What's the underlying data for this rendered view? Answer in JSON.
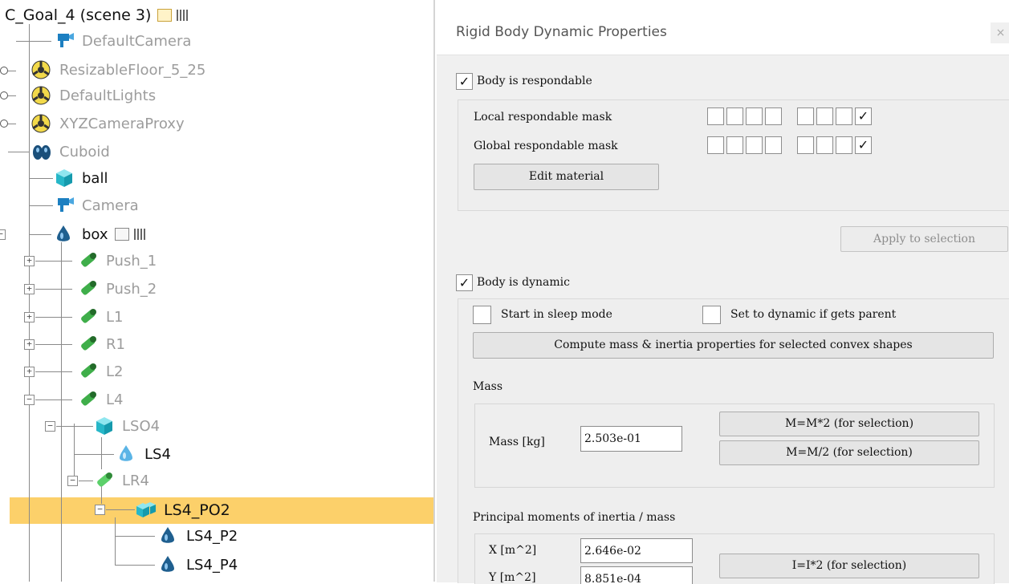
{
  "tree": {
    "header": "C_Goal_4 (scene 3)",
    "items": [
      {
        "label": "DefaultCamera",
        "icon": "camera-icon"
      },
      {
        "label": "ResizableFloor_5_25",
        "icon": "model-icon"
      },
      {
        "label": "DefaultLights",
        "icon": "model-icon"
      },
      {
        "label": "XYZCameraProxy",
        "icon": "model-icon"
      },
      {
        "label": "Cuboid",
        "icon": "pure-shape-icon"
      },
      {
        "label": "ball",
        "icon": "cube-icon"
      },
      {
        "label": "Camera",
        "icon": "camera-icon"
      },
      {
        "label": "box",
        "icon": "drop-shape-icon"
      },
      {
        "label": "Push_1",
        "icon": "joint-icon"
      },
      {
        "label": "Push_2",
        "icon": "joint-icon"
      },
      {
        "label": "L1",
        "icon": "joint-icon"
      },
      {
        "label": "R1",
        "icon": "joint-icon"
      },
      {
        "label": "L2",
        "icon": "joint-icon"
      },
      {
        "label": "L4",
        "icon": "joint-icon"
      },
      {
        "label": "LSO4",
        "icon": "cube-icon"
      },
      {
        "label": "LS4",
        "icon": "drop-shape-icon"
      },
      {
        "label": "LR4",
        "icon": "joint-icon"
      },
      {
        "label": "LS4_PO2",
        "icon": "compound-shape-icon"
      },
      {
        "label": "LS4_P2",
        "icon": "drop-shape-icon"
      },
      {
        "label": "LS4_P4",
        "icon": "drop-shape-icon"
      }
    ],
    "selected_label": "LS4_PO2"
  },
  "dialog": {
    "title": "Rigid Body Dynamic Properties",
    "close_label": "×",
    "respondable": {
      "checkbox_label": "Body is respondable",
      "checked": true,
      "local_mask_label": "Local respondable mask",
      "global_mask_label": "Global respondable mask",
      "local_mask_bits": [
        false,
        false,
        false,
        false,
        false,
        false,
        false,
        true
      ],
      "global_mask_bits": [
        false,
        false,
        false,
        false,
        false,
        false,
        false,
        true
      ],
      "edit_material_label": "Edit material"
    },
    "apply_label": "Apply to selection",
    "dynamic": {
      "checkbox_label": "Body is dynamic",
      "checked": true,
      "sleep_label": "Start in sleep mode",
      "sleep_checked": false,
      "parent_label": "Set to dynamic if gets parent",
      "parent_checked": false,
      "compute_label": "Compute mass & inertia properties for selected convex shapes"
    },
    "mass": {
      "section_label": "Mass",
      "field_label": "Mass [kg]",
      "value": "2.503e-01",
      "double_label": "M=M*2  (for selection)",
      "half_label": "M=M/2  (for selection)"
    },
    "inertia": {
      "section_label": "Principal moments of inertia / mass",
      "x_label": "X [m^2]",
      "x_value": "2.646e-02",
      "y_label": "Y [m^2]",
      "y_value": "8.851e-04",
      "double_label": "I=I*2  (for selection)"
    }
  },
  "check_mark": "✓"
}
